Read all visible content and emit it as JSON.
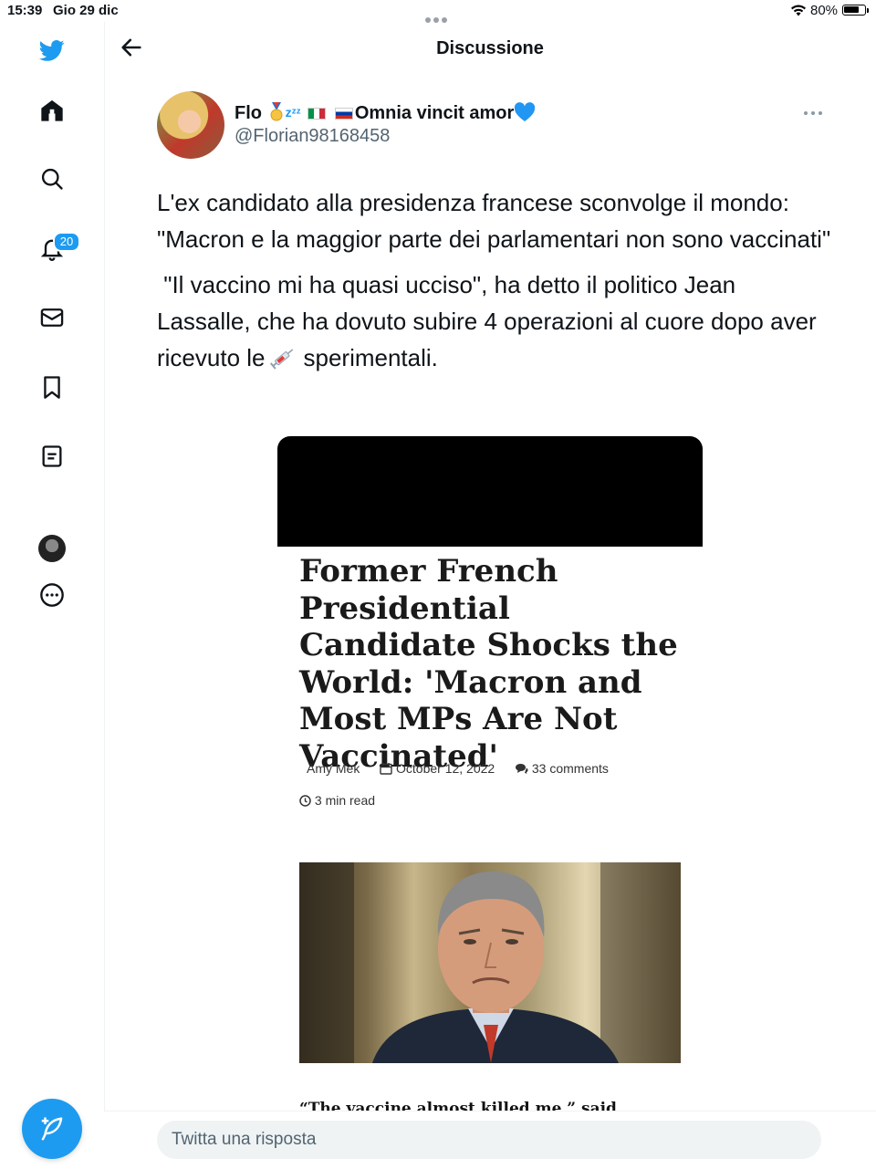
{
  "status_bar": {
    "time": "15:39",
    "date": "Gio 29 dic",
    "battery": "80%",
    "battery_level": 0.8
  },
  "sidebar": {
    "items": [
      {
        "icon": "twitter-bird-icon"
      },
      {
        "icon": "home-icon"
      },
      {
        "icon": "search-icon"
      },
      {
        "icon": "bell-icon",
        "badge": "20"
      },
      {
        "icon": "mail-icon"
      },
      {
        "icon": "bookmark-icon"
      },
      {
        "icon": "list-icon"
      },
      {
        "icon": "profile-avatar"
      },
      {
        "icon": "more-circle-icon"
      }
    ],
    "compose_icon": "compose-feather-icon"
  },
  "header": {
    "title": "Discussione",
    "back_icon": "back-arrow-icon"
  },
  "tweet": {
    "name_prefix": "Flo",
    "name_suffix": "Omnia vincit amor",
    "handle": "@Florian98168458",
    "paragraph1": "L'ex candidato alla presidenza francese sconvolge il mondo: \"Macron e la maggior parte dei parlamentari non sono vaccinati\"",
    "paragraph2_a": " \"Il vaccino mi ha quasi ucciso\", ha detto il politico Jean Lassalle, che ha dovuto subire 4 operazioni al cuore dopo aver ricevuto le",
    "paragraph2_b": "sperimentali.",
    "brand_color": "#1d9bf0"
  },
  "article_image": {
    "title": "Former French Presidential Candidate Shocks the World: 'Macron and Most MPs Are Not Vaccinated'",
    "author": "Amy Mek",
    "date": "October 12, 2022",
    "comments": "33 comments",
    "read_time": "3 min read",
    "quote": "“The vaccine almost killed me,” said"
  },
  "reply": {
    "placeholder": "Twitta una risposta"
  }
}
